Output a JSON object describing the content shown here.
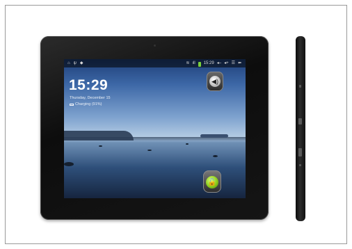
{
  "status_bar": {
    "time": "15:29",
    "icons_left": [
      "home-icon",
      "usb-icon",
      "android-icon"
    ],
    "icons_right": [
      "wifi-icon",
      "signal-icon",
      "battery-icon",
      "volume-down-icon",
      "volume-up-icon",
      "menu-icon",
      "back-icon"
    ],
    "battery_color": "#7ad13b"
  },
  "lock_screen": {
    "clock": "15:29",
    "date": "Thursday, December 15",
    "charging_status": "Charging (91%)"
  },
  "controls": {
    "sound_toggle_icon": "speaker-icon",
    "unlock_icon": "unlock-icon",
    "unlock_color": "#8ccc1d"
  }
}
